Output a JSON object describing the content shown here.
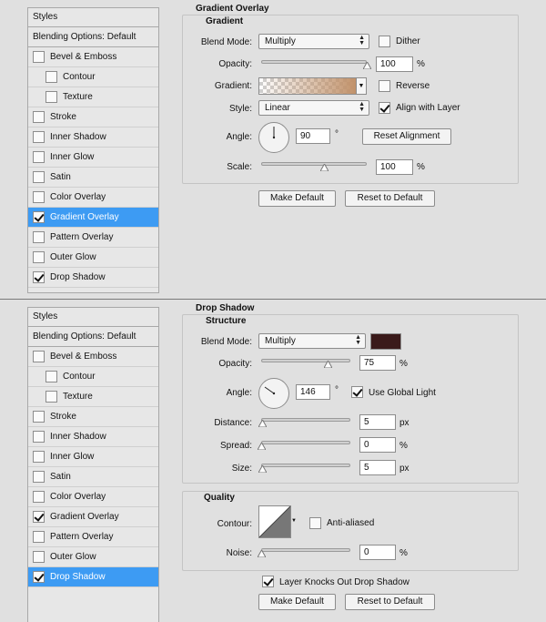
{
  "styles_panel": {
    "header": "Styles",
    "blending_options": "Blending Options: Default",
    "items": [
      "Bevel & Emboss",
      "Contour",
      "Texture",
      "Stroke",
      "Inner Shadow",
      "Inner Glow",
      "Satin",
      "Color Overlay",
      "Gradient Overlay",
      "Pattern Overlay",
      "Outer Glow",
      "Drop Shadow"
    ]
  },
  "top": {
    "selected_item": "Gradient Overlay",
    "checked_items": [
      "Gradient Overlay",
      "Drop Shadow"
    ],
    "section_title": "Gradient Overlay",
    "group_title": "Gradient",
    "blend_mode_label": "Blend Mode:",
    "blend_mode_value": "Multiply",
    "dither_label": "Dither",
    "dither_checked": false,
    "opacity_label": "Opacity:",
    "opacity_value": "100",
    "opacity_unit": "%",
    "opacity_fraction": 1.0,
    "gradient_label": "Gradient:",
    "gradient_end_color": "#c1926b",
    "reverse_label": "Reverse",
    "reverse_checked": false,
    "style_label": "Style:",
    "style_value": "Linear",
    "align_label": "Align with Layer",
    "align_checked": true,
    "angle_label": "Angle:",
    "angle_value": "90",
    "angle_unit": "°",
    "reset_alignment_label": "Reset Alignment",
    "scale_label": "Scale:",
    "scale_value": "100",
    "scale_unit": "%",
    "scale_fraction": 0.6,
    "make_default_label": "Make Default",
    "reset_default_label": "Reset to Default"
  },
  "bottom": {
    "selected_item": "Drop Shadow",
    "checked_items": [
      "Gradient Overlay",
      "Drop Shadow"
    ],
    "section_title": "Drop Shadow",
    "group_title": "Structure",
    "blend_mode_label": "Blend Mode:",
    "blend_mode_value": "Multiply",
    "shadow_color": "#3a1a1a",
    "opacity_label": "Opacity:",
    "opacity_value": "75",
    "opacity_unit": "%",
    "opacity_fraction": 0.75,
    "angle_label": "Angle:",
    "angle_value": "146",
    "angle_unit": "°",
    "global_light_label": "Use Global Light",
    "global_light_checked": true,
    "distance_label": "Distance:",
    "distance_value": "5",
    "distance_unit": "px",
    "distance_fraction": 0.02,
    "spread_label": "Spread:",
    "spread_value": "0",
    "spread_unit": "%",
    "spread_fraction": 0.0,
    "size_label": "Size:",
    "size_value": "5",
    "size_unit": "px",
    "size_fraction": 0.02,
    "quality_title": "Quality",
    "contour_label": "Contour:",
    "anti_aliased_label": "Anti-aliased",
    "anti_aliased_checked": false,
    "noise_label": "Noise:",
    "noise_value": "0",
    "noise_unit": "%",
    "noise_fraction": 0.0,
    "knocks_out_label": "Layer Knocks Out Drop Shadow",
    "knocks_out_checked": true,
    "make_default_label": "Make Default",
    "reset_default_label": "Reset to Default"
  }
}
